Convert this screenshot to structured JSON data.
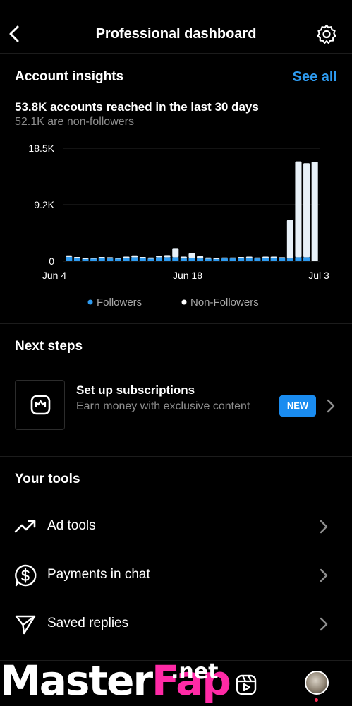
{
  "header": {
    "title": "Professional dashboard",
    "back_icon": "chevron-left-icon",
    "settings_icon": "gear-icon"
  },
  "insights": {
    "title": "Account insights",
    "see_all": "See all",
    "reach": "53.8K accounts reached in the last 30 days",
    "non_followers": "52.1K are non-followers"
  },
  "chart_data": {
    "type": "bar",
    "stacked": true,
    "y_ticks": [
      "18.5K",
      "9.2K",
      "0"
    ],
    "x_ticks": [
      "Jun 4",
      "Jun 18",
      "Jul 3"
    ],
    "ylim": [
      0,
      18500
    ],
    "grid": true,
    "legend_position": "bottom",
    "series": [
      {
        "name": "Followers",
        "color": "#2e9bf0",
        "values": [
          700,
          500,
          350,
          400,
          500,
          450,
          400,
          550,
          650,
          500,
          400,
          650,
          650,
          650,
          450,
          550,
          450,
          400,
          350,
          450,
          450,
          500,
          550,
          450,
          550,
          550,
          500,
          450,
          650,
          650
        ]
      },
      {
        "name": "Non-Followers",
        "color": "#e8f1f8",
        "values": [
          250,
          200,
          150,
          150,
          200,
          200,
          150,
          200,
          300,
          200,
          200,
          250,
          350,
          1500,
          300,
          750,
          400,
          200,
          150,
          150,
          150,
          200,
          200,
          150,
          200,
          200,
          150,
          6300,
          15700,
          15400,
          16300
        ]
      }
    ]
  },
  "legend": {
    "followers": "Followers",
    "non_followers": "Non-Followers"
  },
  "next_steps": {
    "title": "Next steps",
    "card_icon": "crown-bag-icon",
    "card_title": "Set up subscriptions",
    "card_subtitle": "Earn money with exclusive content",
    "badge": "NEW"
  },
  "tools": {
    "title": "Your tools",
    "items": [
      {
        "label": "Ad tools",
        "icon": "trend-up-icon"
      },
      {
        "label": "Payments in chat",
        "icon": "dollar-bubble-icon"
      },
      {
        "label": "Saved replies",
        "icon": "send-icon"
      }
    ]
  },
  "watermark": {
    "part1": "Master",
    "part2": "Fap",
    "part3": ".net"
  },
  "bottom_nav": {
    "reels_icon": "reels-icon",
    "profile_icon": "avatar"
  }
}
